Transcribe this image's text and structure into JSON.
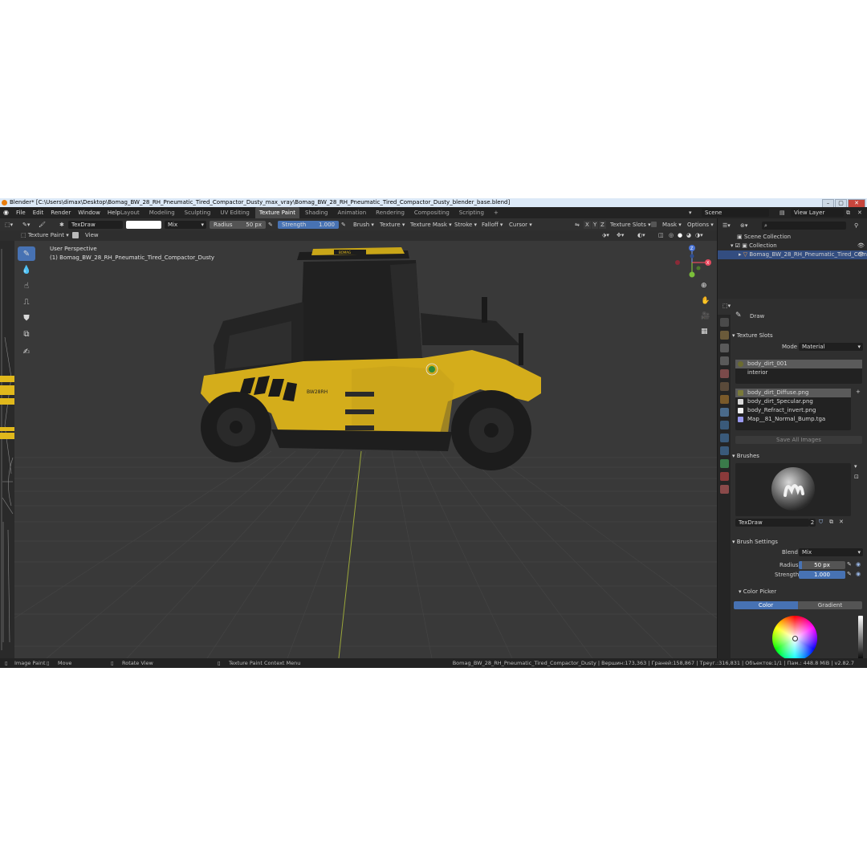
{
  "window": {
    "title": "Blender* [C:\\Users\\dimax\\Desktop\\Bomag_BW_28_RH_Pneumatic_Tired_Compactor_Dusty_max_vray\\Bomag_BW_28_RH_Pneumatic_Tired_Compactor_Dusty_blender_base.blend]"
  },
  "menu": [
    "File",
    "Edit",
    "Render",
    "Window",
    "Help"
  ],
  "workspaces": [
    "Layout",
    "Modeling",
    "Sculpting",
    "UV Editing",
    "Texture Paint",
    "Shading",
    "Animation",
    "Rendering",
    "Compositing",
    "Scripting"
  ],
  "active_workspace": "Texture Paint",
  "scene": {
    "name": "Scene",
    "view_layer": "View Layer"
  },
  "tool_header": {
    "brush_name": "TexDraw",
    "blend": "Mix",
    "radius_label": "Radius",
    "radius_value": "50 px",
    "strength_label": "Strength",
    "strength_value": "1.000",
    "strength_fraction": 1.0,
    "radius_fraction": 0.55,
    "menus": [
      "Brush",
      "Texture",
      "Texture Mask",
      "Stroke",
      "Falloff",
      "Cursor"
    ],
    "axis": [
      "X",
      "Y",
      "Z"
    ],
    "texture_slots": "Texture Slots",
    "mask": "Mask",
    "options": "Options",
    "mode": "Texture Paint",
    "view": "View"
  },
  "viewport": {
    "perspective": "User Perspective",
    "object": "(1) Bomag_BW_28_RH_Pneumatic_Tired_Compactor_Dusty",
    "gizmo": {
      "x": "X",
      "y": "Y",
      "z": "Z"
    },
    "machine_brand": "BOMAG",
    "machine_model": "BW28RH"
  },
  "outliner": {
    "root": "Scene Collection",
    "collection": "Collection",
    "object": "Bomag_BW_28_RH_Pneumatic_Tired_Comp"
  },
  "properties": {
    "tool_name": "Draw",
    "texture_slots": {
      "header": "Texture Slots",
      "mode_label": "Mode",
      "mode_value": "Material",
      "materials": [
        "body_dirt_001",
        "interior"
      ],
      "images": [
        {
          "name": "body_dirt_Diffuse.png",
          "color": "#7a7a3a"
        },
        {
          "name": "body_dirt_Specular.png",
          "color": "#d8d8d8"
        },
        {
          "name": "body_Refract_invert.png",
          "color": "#f0f0f0"
        },
        {
          "name": "Map__81_Normal_Bump.tga",
          "color": "#9a9af0"
        }
      ],
      "save_all": "Save All Images"
    },
    "brushes": {
      "header": "Brushes",
      "name": "TexDraw",
      "users": "2"
    },
    "brush_settings": {
      "header": "Brush Settings",
      "blend_label": "Blend",
      "blend_value": "Mix",
      "radius_label": "Radius",
      "radius_value": "50 px",
      "strength_label": "Strength",
      "strength_value": "1.000"
    },
    "color_picker": {
      "header": "Color Picker",
      "tab_color": "Color",
      "tab_gradient": "Gradient"
    }
  },
  "statusbar": {
    "image_paint": "Image Paint",
    "move": "Move",
    "rotate": "Rotate View",
    "context_menu": "Texture Paint Context Menu",
    "stats": "Bomag_BW_28_RH_Pneumatic_Tired_Compactor_Dusty | Вершин:173,363 | Граней:158,867 | Треуг.:316,831 | Объектов:1/1 | Пам.: 448.8 MiB | v2.82.7"
  },
  "colors": {
    "accent": "#4772b3",
    "machine_yellow": "#d8b11a",
    "background": "#393939"
  }
}
